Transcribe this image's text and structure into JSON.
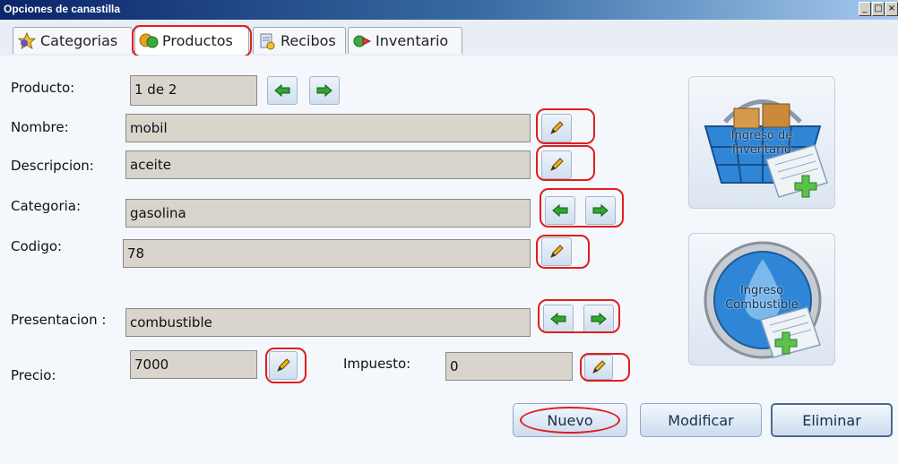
{
  "window": {
    "title": "Opciones de canastilla",
    "controls": [
      "_",
      "□",
      "×"
    ]
  },
  "tabs": [
    {
      "label": "Categorias",
      "icon": "star-icon",
      "active": false
    },
    {
      "label": "Productos",
      "icon": "products-icon",
      "active": true
    },
    {
      "label": "Recibos",
      "icon": "receipt-icon",
      "active": false
    },
    {
      "label": "Inventario",
      "icon": "inventory-icon",
      "active": false
    }
  ],
  "form": {
    "producto": {
      "label": "Producto:",
      "value": "1 de 2"
    },
    "nombre": {
      "label": "Nombre:",
      "value": "mobil"
    },
    "descripcion": {
      "label": "Descripcion:",
      "value": "aceite"
    },
    "categoria": {
      "label": "Categoria:",
      "value": "gasolina"
    },
    "codigo": {
      "label": "Codigo:",
      "value": "78"
    },
    "presentacion": {
      "label": "Presentacion :",
      "value": "combustible"
    },
    "precio": {
      "label": "Precio:",
      "value": "7000"
    },
    "impuesto": {
      "label": "Impuesto:",
      "value": "0"
    }
  },
  "cards": {
    "inventario": {
      "line1": "Ingreso de",
      "line2": "Inventario"
    },
    "combustible": {
      "line1": "Ingreso",
      "line2": "Combustible"
    }
  },
  "actions": {
    "nuevo": "Nuevo",
    "modificar": "Modificar",
    "eliminar": "Eliminar"
  },
  "colors": {
    "highlight": "#e01e1e",
    "arrow": "#2fa82f",
    "titlebar": "#0a246a"
  }
}
